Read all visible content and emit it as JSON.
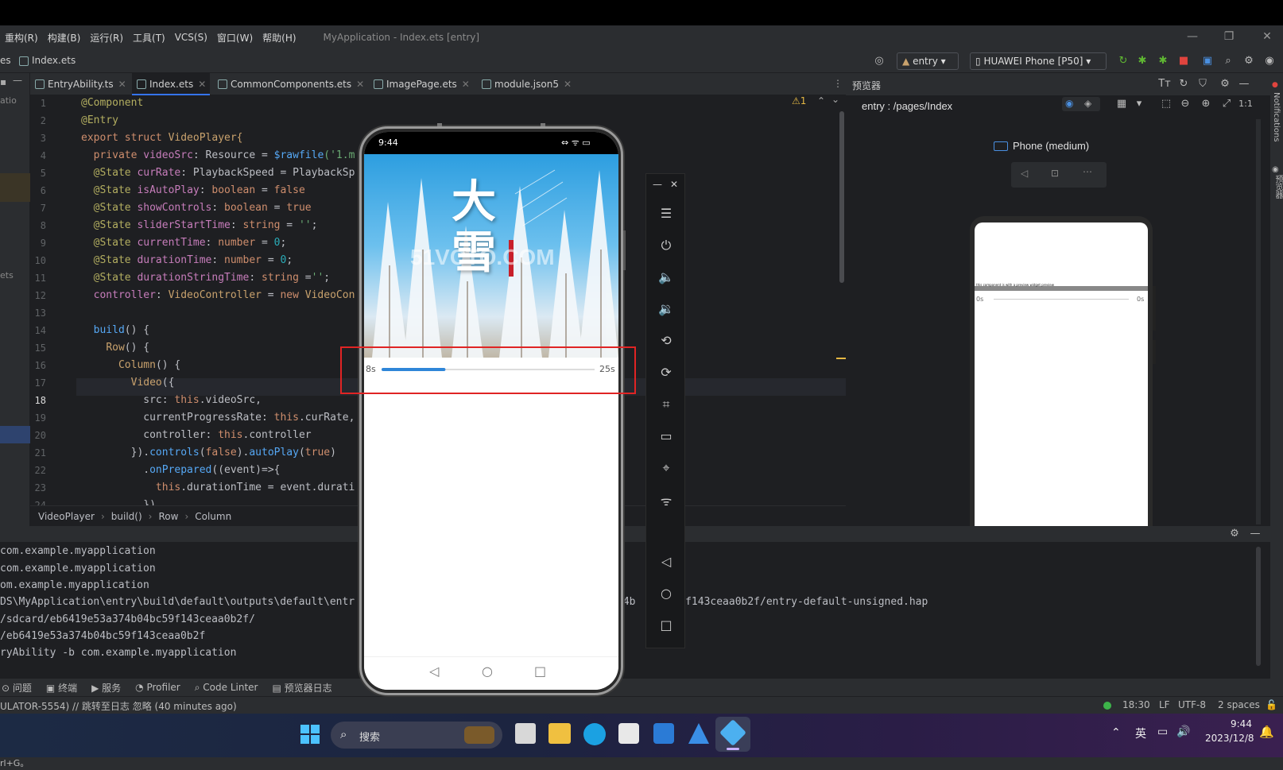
{
  "menubar": {
    "items": [
      "重构(R)",
      "构建(B)",
      "运行(R)",
      "工具(T)",
      "VCS(S)",
      "窗口(W)",
      "帮助(H)"
    ],
    "title": "MyApplication - Index.ets [entry]"
  },
  "nav": {
    "prefix": "es",
    "file": "Index.ets",
    "module": "entry",
    "device": "HUAWEI Phone [P50]"
  },
  "tabs": [
    "EntryAbility.ts",
    "Index.ets",
    "CommonComponents.ets",
    "ImagePage.ets",
    "module.json5"
  ],
  "leftstrip": {
    "t1": "atio",
    "t2": "ets"
  },
  "editor": {
    "warning": "⚠1",
    "lines": [
      "1",
      "2",
      "3",
      "4",
      "5",
      "6",
      "7",
      "8",
      "9",
      "10",
      "11",
      "12",
      "13",
      "14",
      "15",
      "16",
      "17",
      "18",
      "19",
      "20",
      "21",
      "22",
      "23",
      "24"
    ],
    "code": {
      "l1": "@Component",
      "l2": "@Entry",
      "l3a": "export struct ",
      "l3b": "VideoPlayer{",
      "l4a": "  private ",
      "l4b": "videoSrc",
      "l4c": ": Resource = ",
      "l4d": "$rawfile",
      "l4e": "('1.m",
      "l5a": "  @State ",
      "l5b": "curRate",
      "l5c": ": PlaybackSpeed = PlaybackSp",
      "l6a": "  @State ",
      "l6b": "isAutoPlay",
      "l6c": ": ",
      "l6d": "boolean",
      "l6e": " = ",
      "l6f": "false",
      "l7a": "  @State ",
      "l7b": "showControls",
      "l7c": ": ",
      "l7d": "boolean",
      "l7e": " = ",
      "l7f": "true",
      "l8a": "  @State ",
      "l8b": "sliderStartTime",
      "l8c": ": ",
      "l8d": "string",
      "l8e": " = ",
      "l8f": "''",
      ";": ";",
      "l9a": "  @State ",
      "l9b": "currentTime",
      "l9c": ": ",
      "l9d": "number",
      "l9e": " = ",
      "l9f": "0",
      "l10a": "  @State ",
      "l10b": "durationTime",
      "l10c": ": ",
      "l10d": "number",
      "l10e": " = ",
      "l10f": "0",
      "l11a": "  @State ",
      "l11b": "durationStringTime",
      "l11c": ": ",
      "l11d": "string",
      "l11e": " =",
      "l11f": "''",
      "l12a": "  controller",
      "l12b": ": ",
      "l12c": "VideoController",
      "l12d": " = ",
      "l12e": "new ",
      "l12f": "VideoCon",
      "l14a": "  ",
      "l14b": "build",
      "l14c": "() {",
      "l15a": "    ",
      "l15b": "Row",
      "l15c": "() {",
      "l16a": "      ",
      "l16b": "Column",
      "l16c": "() {",
      "l17a": "        ",
      "l17b": "Video",
      "l17c": "({",
      "l18a": "          src: ",
      "l18b": "this",
      "l18c": ".videoSrc,",
      "l19a": "          currentProgressRate: ",
      "l19b": "this",
      "l19c": ".curRate,",
      "l20a": "          controller: ",
      "l20b": "this",
      "l20c": ".controller",
      "l21a": "        }).",
      "l21b": "controls",
      "l21c": "(",
      "l21d": "false",
      "l21e": ").",
      "l21f": "autoPlay",
      "l21g": "(",
      "l21h": "true",
      "l21i": ")",
      "l22a": "          .",
      "l22b": "onPrepared",
      "l22c": "((event)=>{",
      "l23a": "            ",
      "l23b": "this",
      "l23c": ".durationTime = event.durati",
      "l24": "          })"
    }
  },
  "breadcrumb": [
    "VideoPlayer",
    "build()",
    "Row",
    "Column"
  ],
  "preview": {
    "header": "预览器",
    "path": "entry : /pages/Index",
    "device": "Phone (medium)",
    "mini_left": "0s",
    "mini_right": "0s",
    "mini_caption": "this component is with a preview widget preview",
    "side_label": "预览器",
    "notif_label": "Notifications"
  },
  "console": {
    "lines": [
      "com.example.myapplication",
      "com.example.myapplication",
      "om.example.myapplication",
      "DS\\MyApplication\\entry\\build\\default\\outputs\\default\\entr",
      "/sdcard/eb6419e53a374b04bc59f143ceaa0b2f/",
      "/eb6419e53a374b04bc59f143ceaa0b2f",
      "ryAbility -b com.example.myapplication"
    ],
    "line4_tail": "74b        f143ceaa0b2f/entry-default-unsigned.hap"
  },
  "bottomtabs": [
    "问题",
    "终端",
    "服务",
    "Profiler",
    "Code Linter",
    "预览器日志"
  ],
  "status": {
    "left": "ULATOR-5554) // 跳转至日志  忽略 (40 minutes ago)",
    "pos": "18:30",
    "eol": "LF",
    "enc": "UTF-8",
    "indent": "2 spaces"
  },
  "taskbar": {
    "search": "搜索",
    "ime": "英",
    "time": "9:44",
    "date": "2023/12/8"
  },
  "bottomline": "rl+G。",
  "phone": {
    "time": "9:44",
    "status_icons": "⇔ ᯤ ▭",
    "video_title": "大雪",
    "watermark": "51VCTO.COM",
    "time_left": "8s",
    "time_right": "25s",
    "progress": 0.3
  }
}
